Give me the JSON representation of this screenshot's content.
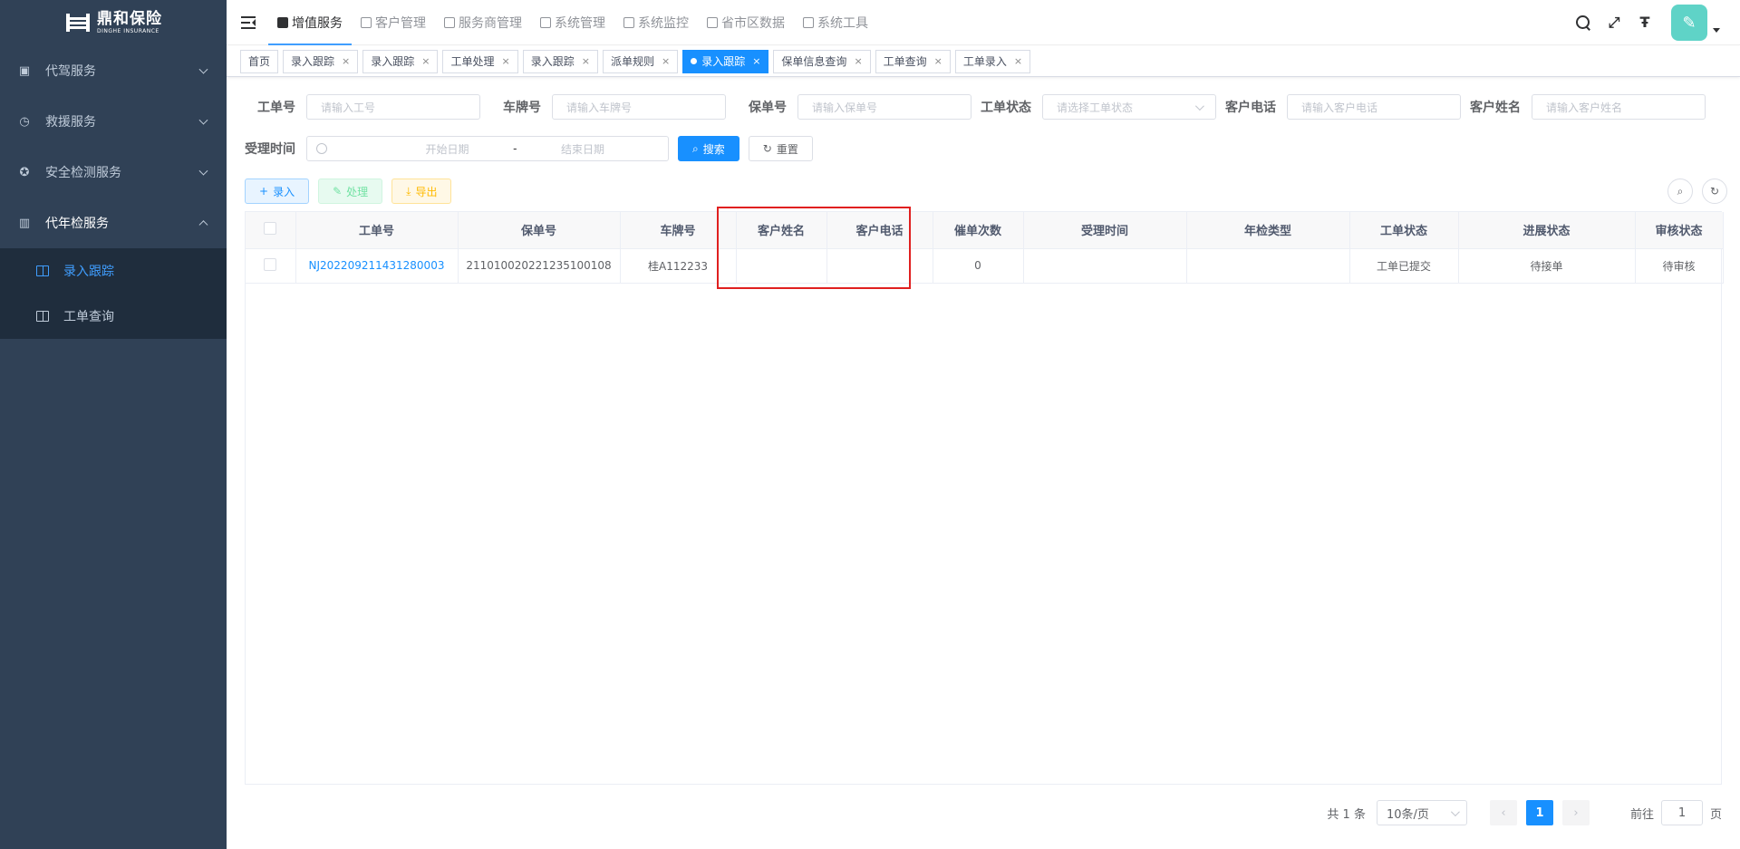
{
  "brand": {
    "name_cn": "鼎和保险",
    "name_en": "DINGHE INSURANCE"
  },
  "sidebar": {
    "items": [
      {
        "label": "代驾服务"
      },
      {
        "label": "救援服务"
      },
      {
        "label": "安全检测服务"
      },
      {
        "label": "代年检服务"
      }
    ],
    "sub_items": [
      {
        "label": "录入跟踪"
      },
      {
        "label": "工单查询"
      }
    ]
  },
  "topnav": {
    "items": [
      {
        "label": "增值服务"
      },
      {
        "label": "客户管理"
      },
      {
        "label": "服务商管理"
      },
      {
        "label": "系统管理"
      },
      {
        "label": "系统监控"
      },
      {
        "label": "省市区数据"
      },
      {
        "label": "系统工具"
      }
    ]
  },
  "tags": [
    {
      "label": "首页"
    },
    {
      "label": "录入跟踪"
    },
    {
      "label": "录入跟踪"
    },
    {
      "label": "工单处理"
    },
    {
      "label": "录入跟踪"
    },
    {
      "label": "派单规则"
    },
    {
      "label": "录入跟踪"
    },
    {
      "label": "保单信息查询"
    },
    {
      "label": "工单查询"
    },
    {
      "label": "工单录入"
    }
  ],
  "tag_close": "×",
  "filters": {
    "order_no": {
      "label": "工单号",
      "placeholder": "请输入工号"
    },
    "plate": {
      "label": "车牌号",
      "placeholder": "请输入车牌号"
    },
    "policy": {
      "label": "保单号",
      "placeholder": "请输入保单号"
    },
    "status": {
      "label": "工单状态",
      "placeholder": "请选择工单状态"
    },
    "phone": {
      "label": "客户电话",
      "placeholder": "请输入客户电话"
    },
    "name": {
      "label": "客户姓名",
      "placeholder": "请输入客户姓名"
    },
    "time": {
      "label": "受理时间",
      "start": "开始日期",
      "sep": "-",
      "end": "结束日期"
    }
  },
  "buttons": {
    "search": "搜索",
    "reset": "重置",
    "add": "录入",
    "process": "处理",
    "export": "导出"
  },
  "table": {
    "headers": [
      "工单号",
      "保单号",
      "车牌号",
      "客户姓名",
      "客户电话",
      "催单次数",
      "受理时间",
      "年检类型",
      "工单状态",
      "进展状态",
      "审核状态"
    ],
    "rows": [
      {
        "order_no": "NJ202209211431280003",
        "policy": "211010020221235100108",
        "plate": "桂A112233",
        "name": "",
        "phone": "",
        "reminders": "0",
        "time": "",
        "type": "",
        "status": "工单已提交",
        "progress": "待接单",
        "review": "待审核"
      }
    ]
  },
  "pagination": {
    "total": "共 1 条",
    "page_size": "10条/页",
    "current": "1",
    "goto_label": "前往",
    "goto_value": "1",
    "page_suffix": "页"
  }
}
